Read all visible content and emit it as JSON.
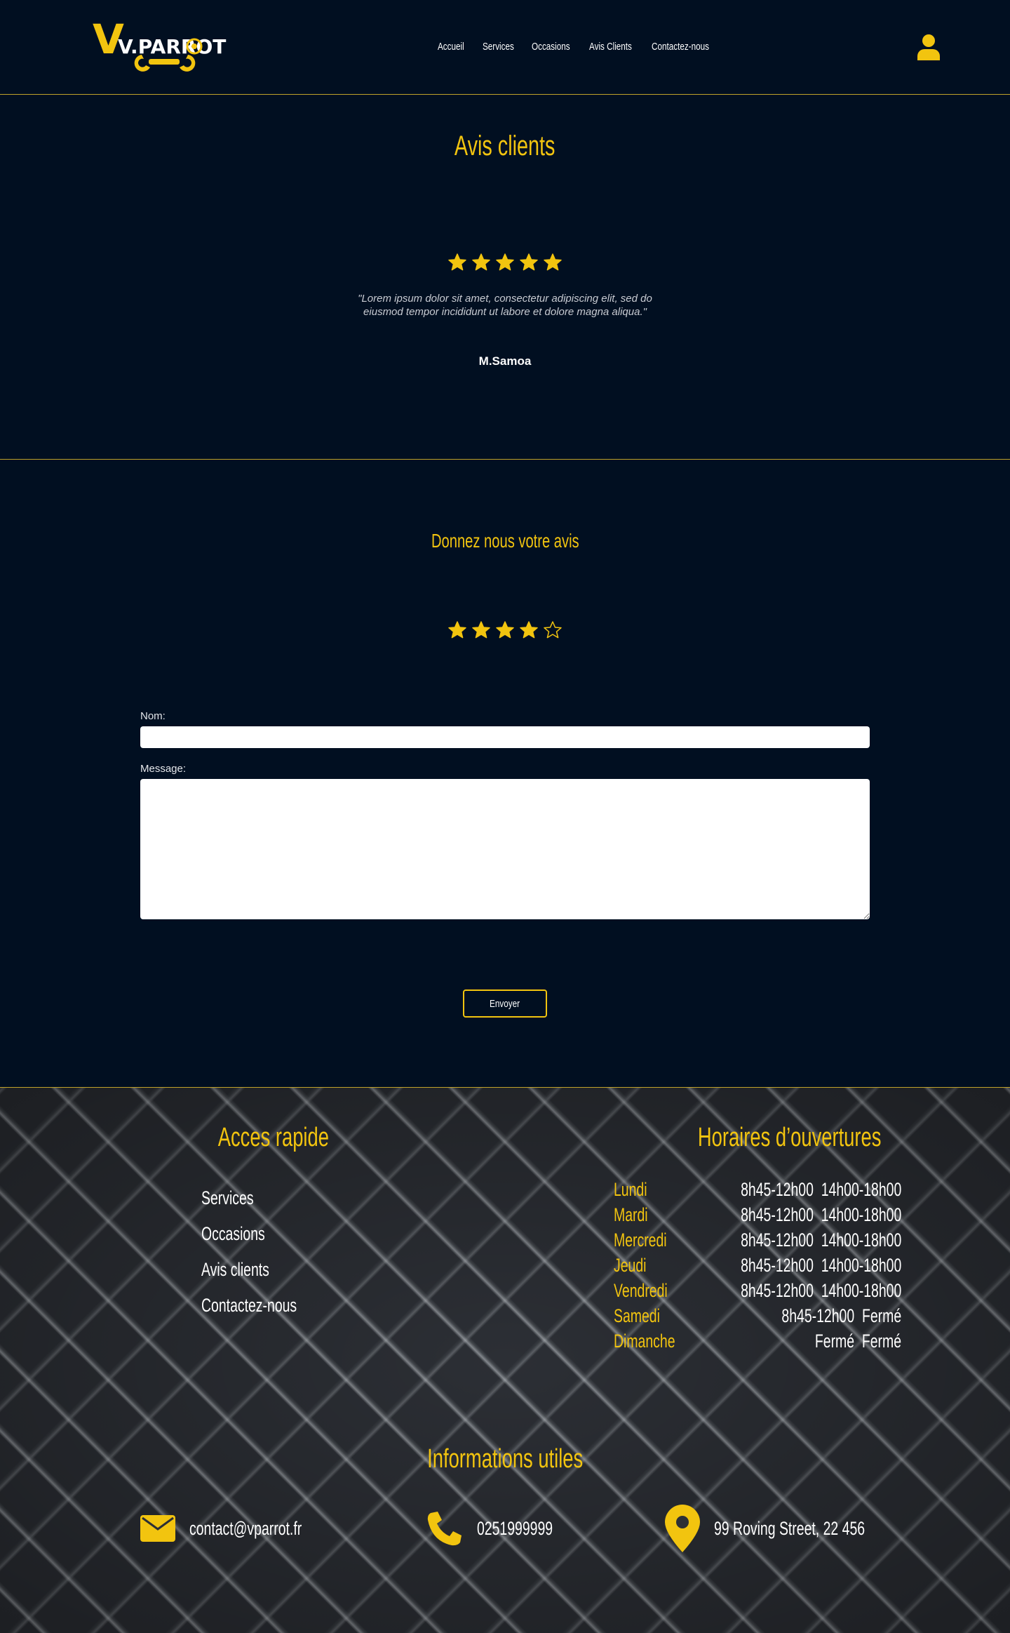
{
  "header": {
    "logo_text": "V.PARROT",
    "nav": [
      "Accueil",
      "Services",
      "Occasions",
      "Avis Clients",
      "Contactez-nous"
    ]
  },
  "reviews": {
    "title": "Avis clients",
    "rating": 5,
    "quote": "\"Lorem ipsum dolor sit amet, consectetur adipiscing elit, sed do eiusmod tempor incididunt ut labore et dolore magna aliqua.\"",
    "author": "M.Samoa"
  },
  "form": {
    "title": "Donnez nous votre avis",
    "rating": 4,
    "rating_max": 5,
    "name_label": "Nom:",
    "name_value": "",
    "message_label": "Message:",
    "message_value": "",
    "submit_label": "Envoyer"
  },
  "footer": {
    "quick_access_title": "Acces rapide",
    "quick_links": [
      "Services",
      "Occasions",
      "Avis clients",
      "Contactez-nous"
    ],
    "hours_title": "Horaires d’ouvertures",
    "hours": [
      {
        "day": "Lundi",
        "times": "8h45-12h00  14h00-18h00"
      },
      {
        "day": "Mardi",
        "times": "8h45-12h00  14h00-18h00"
      },
      {
        "day": "Mercredi",
        "times": "8h45-12h00  14h00-18h00"
      },
      {
        "day": "Jeudi",
        "times": "8h45-12h00  14h00-18h00"
      },
      {
        "day": "Vendredi",
        "times": "8h45-12h00  14h00-18h00"
      },
      {
        "day": "Samedi",
        "times": "8h45-12h00  Fermé"
      },
      {
        "day": "Dimanche",
        "times": "Fermé  Fermé"
      }
    ],
    "info_title": "Informations utiles",
    "email": "contact@vparrot.fr",
    "phone": "0251999999",
    "address": "99 Roving Street, 22 456"
  },
  "colors": {
    "accent": "#f2c40f",
    "background": "#010f21",
    "divider": "#bfa22a"
  },
  "icons": [
    "logo-wrench-icon",
    "user-icon",
    "star-icon",
    "star-outline-icon",
    "envelope-icon",
    "phone-icon",
    "map-pin-icon"
  ]
}
